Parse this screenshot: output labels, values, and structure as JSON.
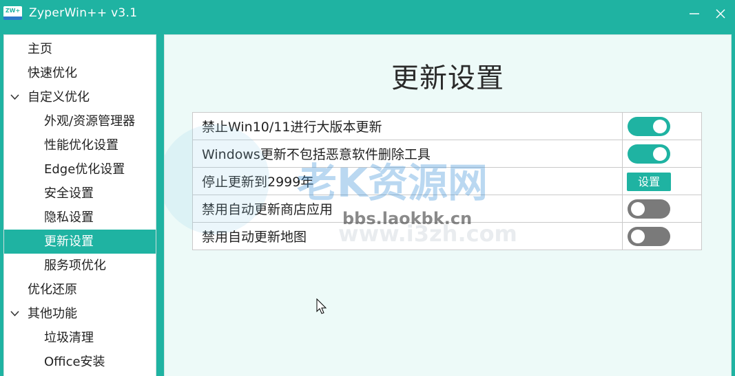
{
  "window": {
    "app_icon_text": "ZW+",
    "title": "ZyperWin++ v3.1",
    "minimize_icon": "minimize-icon",
    "close_icon": "close-icon"
  },
  "sidebar": {
    "items": [
      {
        "label": "主页",
        "level": 0
      },
      {
        "label": "快速优化",
        "level": 0
      },
      {
        "label": "自定义优化",
        "level": 0,
        "expanded": true
      },
      {
        "label": "外观/资源管理器",
        "level": 1
      },
      {
        "label": "性能优化设置",
        "level": 1
      },
      {
        "label": "Edge优化设置",
        "level": 1
      },
      {
        "label": "安全设置",
        "level": 1
      },
      {
        "label": "隐私设置",
        "level": 1
      },
      {
        "label": "更新设置",
        "level": 1,
        "selected": true
      },
      {
        "label": "服务项优化",
        "level": 1
      },
      {
        "label": "优化还原",
        "level": 0
      },
      {
        "label": "其他功能",
        "level": 0,
        "expanded": true
      },
      {
        "label": "垃圾清理",
        "level": 1
      },
      {
        "label": "Office安装",
        "level": 1
      }
    ]
  },
  "main": {
    "title": "更新设置",
    "settings": [
      {
        "label": "禁止Win10/11进行大版本更新",
        "control": "toggle",
        "on": true
      },
      {
        "label": "Windows更新不包括恶意软件删除工具",
        "control": "toggle",
        "on": true
      },
      {
        "label": "停止更新到2999年",
        "control": "button",
        "button_label": "设置"
      },
      {
        "label": "禁用自动更新商店应用",
        "control": "toggle",
        "on": false
      },
      {
        "label": "禁用自动更新地图",
        "control": "toggle",
        "on": false
      }
    ]
  },
  "watermark": {
    "line1": "老K资源网",
    "line2": "bbs.laokbk.cn",
    "line3": "www.i3zh.com"
  },
  "colors": {
    "accent": "#1fb3a2",
    "toggle_off": "#7a7a7a",
    "main_bg": "#edfaf8"
  }
}
